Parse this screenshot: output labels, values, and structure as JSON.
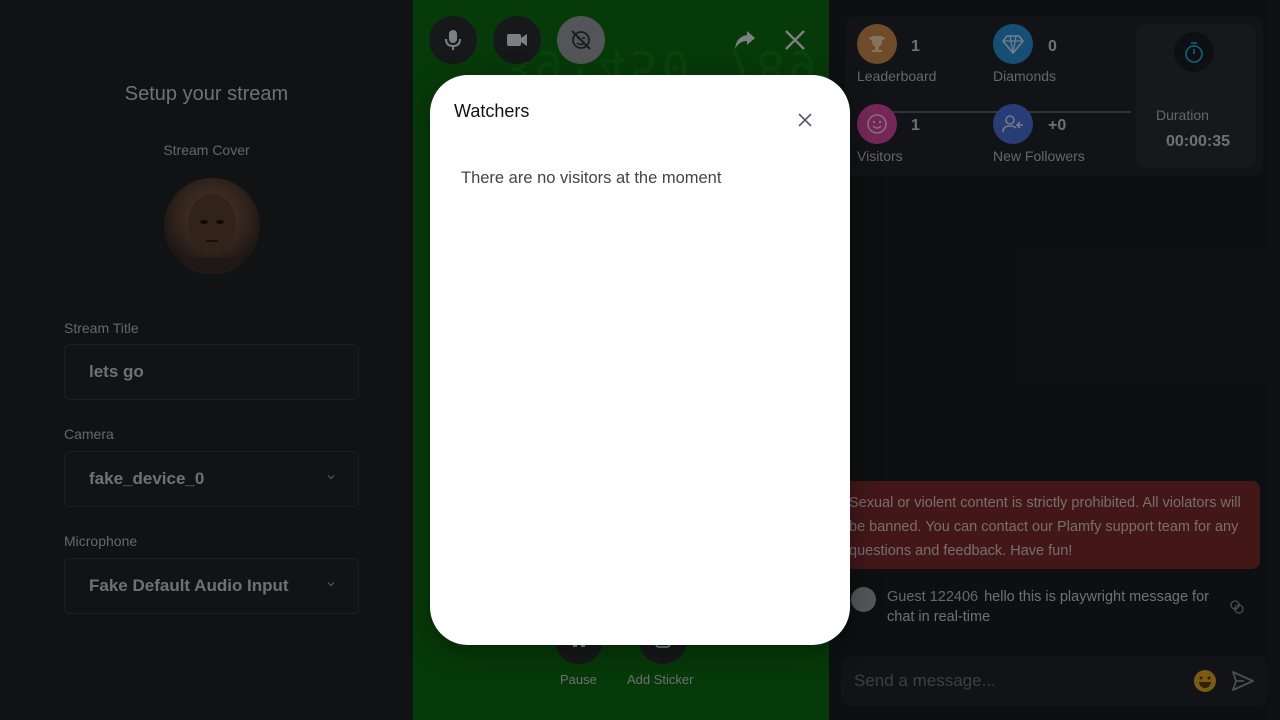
{
  "setup": {
    "title": "Setup your stream",
    "cover_label": "Stream Cover",
    "stream_title_label": "Stream Title",
    "stream_title_value": "lets go",
    "camera_label": "Camera",
    "camera_value": "fake_device_0",
    "microphone_label": "Microphone",
    "microphone_value": "Fake Default Audio Input"
  },
  "video": {
    "background_digits": "39:450 789",
    "controls": [
      "microphone-icon",
      "camera-icon",
      "effects-off-icon",
      "share-icon",
      "close-icon"
    ],
    "bottom_buttons": [
      {
        "label": "Pause",
        "icon": "pause-icon"
      },
      {
        "label": "Add Sticker",
        "icon": "sticker-icon"
      }
    ]
  },
  "stats": {
    "leaderboard": {
      "label": "Leaderboard",
      "value": "1",
      "color": "#c98a4b"
    },
    "diamonds": {
      "label": "Diamonds",
      "value": "0",
      "color": "#2a8fd6"
    },
    "visitors": {
      "label": "Visitors",
      "value": "1",
      "color": "#d64a9e"
    },
    "followers": {
      "label": "New Followers",
      "value": "+0",
      "color": "#4a6fd6"
    },
    "duration": {
      "label": "Duration",
      "value": "00:00:35"
    }
  },
  "chat": {
    "notice": "Sexual or violent content is strictly prohibited. All violators will be banned. You can contact our Plamfy support team for any questions and feedback. Have fun!",
    "messages": [
      {
        "user": "Guest 122406",
        "text": "hello this is playwright message for chat in real-time"
      }
    ],
    "input_placeholder": "Send a message..."
  },
  "modal": {
    "title": "Watchers",
    "empty_text": "There are no visitors at the moment"
  },
  "colors": {
    "video_bg": "#0d6b12",
    "notice_bg": "#7a2a2d",
    "accent_timer": "#1fa3c8"
  }
}
